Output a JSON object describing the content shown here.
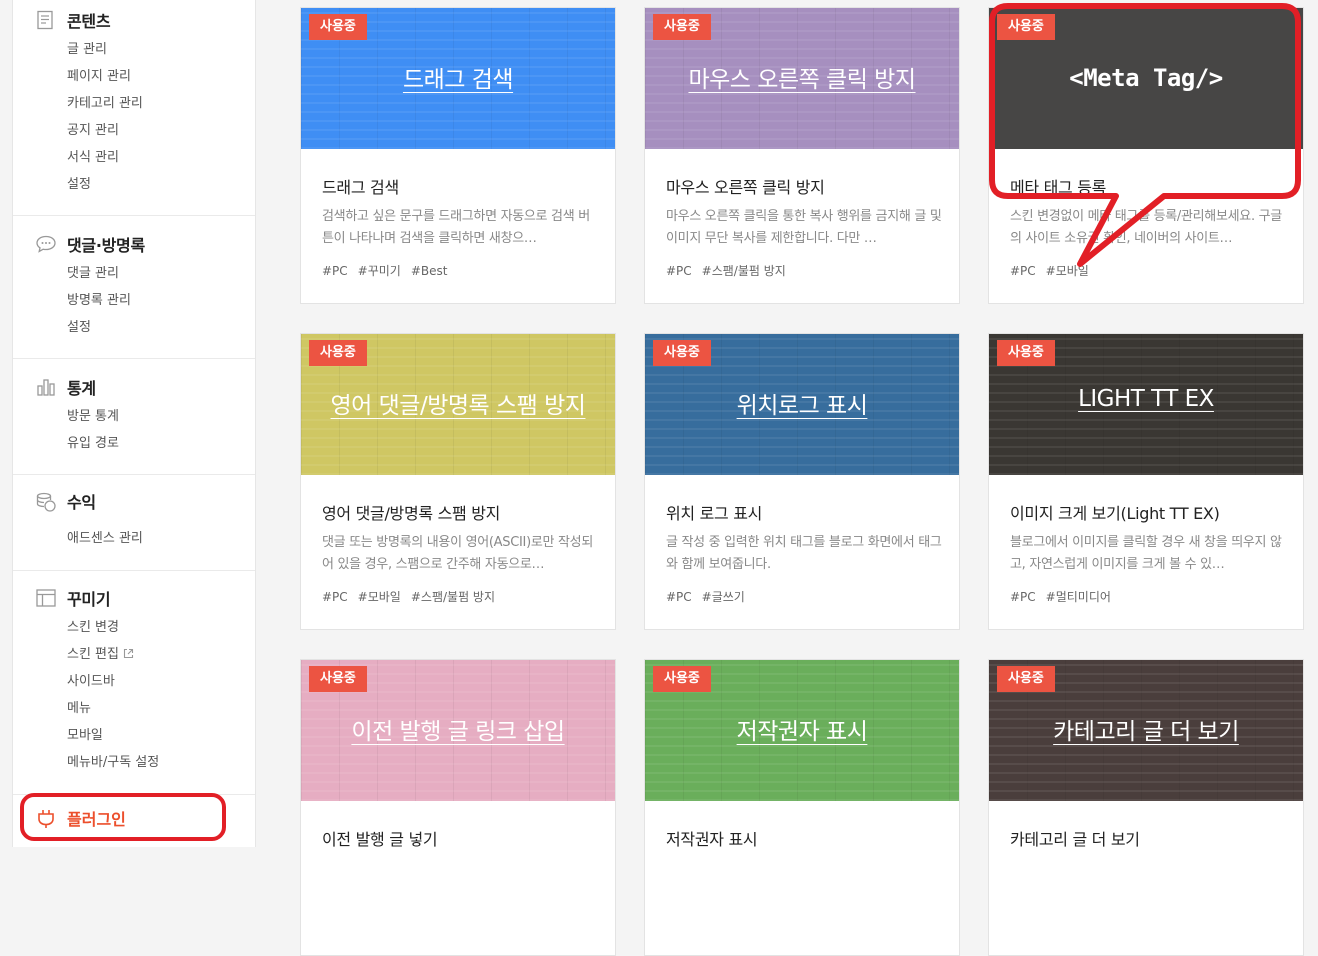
{
  "sidebar": {
    "sections": [
      {
        "title": "콘텐츠",
        "icon": "document-icon",
        "items": [
          "글 관리",
          "페이지 관리",
          "카테고리 관리",
          "공지 관리",
          "서식 관리",
          "설정"
        ]
      },
      {
        "title": "댓글·방명록",
        "icon": "speech-bubble-icon",
        "items": [
          "댓글 관리",
          "방명록 관리",
          "설정"
        ]
      },
      {
        "title": "통계",
        "icon": "bar-chart-icon",
        "items": [
          "방문 통계",
          "유입 경로"
        ]
      },
      {
        "title": "수익",
        "icon": "coins-icon",
        "items": [
          "애드센스 관리"
        ]
      },
      {
        "title": "꾸미기",
        "icon": "layout-icon",
        "items": [
          "스킨 변경",
          "스킨 편집",
          "사이드바",
          "메뉴",
          "모바일",
          "메뉴바/구독 설정"
        ]
      }
    ],
    "plugin": {
      "title": "플러그인",
      "icon": "plug-icon"
    }
  },
  "badge_label": "사용중",
  "cards": [
    {
      "thumb_title": "드래그 검색",
      "color": "#3f8ef4",
      "name": "드래그 검색",
      "desc": "검색하고 싶은 문구를 드래그하면 자동으로 검색 버튼이 나타나며 검색을 클릭하면 새창으…",
      "tags": [
        "#PC",
        "#꾸미기",
        "#Best"
      ]
    },
    {
      "thumb_title": "마우스 오른쪽 클릭 방지",
      "color": "#a68fbf",
      "name": "마우스 오른쪽 클릭 방지",
      "desc": "마우스 오른쪽 클릭을 통한 복사 행위를 금지해 글 및 이미지 무단 복사를 제한합니다. 다만 …",
      "tags": [
        "#PC",
        "#스팸/불펌 방지"
      ]
    },
    {
      "thumb_title": "<Meta Tag/>",
      "color": "#474645",
      "name": "메타 태그 등록",
      "desc": "스킨 변경없이 메타 태그를 등록/관리해보세요. 구글의 사이트 소유권 확인, 네이버의 사이트…",
      "tags": [
        "#PC",
        "#모바일"
      ]
    },
    {
      "thumb_title": "영어 댓글/방명록 스팸 방지",
      "color": "#cfc763",
      "name": "영어 댓글/방명록 스팸 방지",
      "desc": "댓글 또는 방명록의 내용이 영어(ASCII)로만 작성되어 있을 경우, 스팸으로 간주해 자동으로…",
      "tags": [
        "#PC",
        "#모바일",
        "#스팸/불펌 방지"
      ]
    },
    {
      "thumb_title": "위치로그 표시",
      "color": "#376d9d",
      "name": "위치 로그 표시",
      "desc": "글 작성 중 입력한 위치 태그를 블로그 화면에서 태그와 함께 보여줍니다.",
      "tags": [
        "#PC",
        "#글쓰기"
      ]
    },
    {
      "thumb_title": "LIGHT TT EX",
      "color": "#3a3733",
      "name": "이미지 크게 보기(Light TT EX)",
      "desc": "블로그에서 이미지를 클릭할 경우 새 창을 띄우지 않고, 자연스럽게 이미지를 크게 볼 수 있…",
      "tags": [
        "#PC",
        "#멀티미디어"
      ]
    },
    {
      "thumb_title": "이전 발행 글 링크 삽입",
      "color": "#e6adc2",
      "name": "이전 발행 글 넣기",
      "desc": "",
      "tags": []
    },
    {
      "thumb_title": "저작권자 표시",
      "color": "#6aae5b",
      "name": "저작권자 표시",
      "desc": "",
      "tags": []
    },
    {
      "thumb_title": "카테고리 글 더 보기",
      "color": "#4a3e3c",
      "name": "카테고리 글 더 보기",
      "desc": "",
      "tags": []
    }
  ],
  "highlight_color": "#e21f26"
}
